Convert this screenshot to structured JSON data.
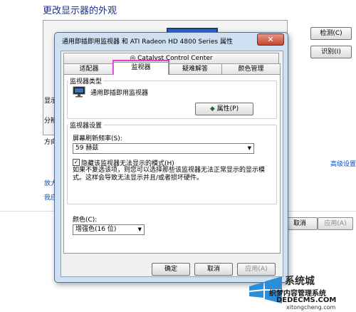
{
  "background": {
    "title": "更改显示器的外观",
    "detect_button": "检测(C)",
    "identify_button": "识别(I)",
    "display_label": "显示",
    "resolution_label": "分辨",
    "orientation_label": "方向",
    "advanced_link": "高级设置",
    "enlarge_link": "放大",
    "which_link": "我应",
    "apply_button_partial": "取消",
    "apply_button": "应用(A)"
  },
  "dialog": {
    "title": "通用即插即用监视器 和 ATI Radeon HD 4800 Series 属性",
    "close_glyph": "✕",
    "catalyst_tab": "Catalyst Control Center",
    "tabs": [
      "适配器",
      "监视器",
      "疑难解答",
      "颜色管理"
    ],
    "active_tab": "监视器",
    "monitor_type_label": "监视器类型",
    "monitor_name": "通用即插即用监视器",
    "properties_button": "属性(P)",
    "monitor_settings_label": "监视器设置",
    "refresh_rate_label": "屏幕刷新频率(S):",
    "refresh_rate_value": "59 赫兹",
    "hide_modes_label": "隐藏该监视器无法显示的模式(H)",
    "hide_modes_checked": true,
    "warning_text": "如果不复选该项，则您可以选择那些该监视器无法正常显示的显示模式。这样会导致无法显示并且/或者损坏硬件。",
    "colors_label": "颜色(C):",
    "colors_value": "增强色(16 位)",
    "ok_button": "确定",
    "cancel_button": "取消",
    "apply_button": "应用(A)"
  },
  "watermark": {
    "line1": "系统城",
    "line2": "织梦内容管理系统",
    "line3": "DEDECMS.COM",
    "line4": "xitongcheng.com"
  },
  "colors": {
    "highlight": "#e040d8",
    "link": "#0a4fc8",
    "dialog_frame": "#cfe0f3"
  }
}
